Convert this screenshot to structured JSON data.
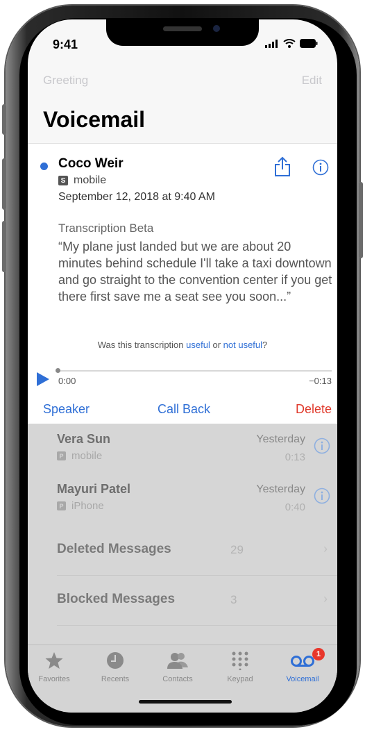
{
  "status": {
    "time": "9:41"
  },
  "nav": {
    "left": "Greeting",
    "right": "Edit",
    "title": "Voicemail"
  },
  "voicemail": {
    "caller": "Coco Weir",
    "label_badge": "S",
    "label": "mobile",
    "date": "September 12, 2018 at 9:40 AM",
    "transcription_title": "Transcription Beta",
    "transcription": "“My plane just landed but we are about 20 minutes behind schedule I'll take a taxi downtown and go straight to the convention center if you get there first save me a seat see you soon...”",
    "feedback_prefix": "Was this transcription",
    "feedback_useful": "useful",
    "feedback_or": "or",
    "feedback_not_useful": "not useful",
    "feedback_suffix": "?",
    "time_start": "0:00",
    "time_end": "−0:13",
    "progress": 0,
    "speaker": "Speaker",
    "call_back": "Call Back",
    "delete": "Delete"
  },
  "messages": [
    {
      "name": "Vera Sun",
      "badge": "P",
      "label": "mobile",
      "date": "Yesterday",
      "duration": "0:13"
    },
    {
      "name": "Mayuri Patel",
      "badge": "P",
      "label": "iPhone",
      "date": "Yesterday",
      "duration": "0:40"
    }
  ],
  "folders": [
    {
      "name": "Deleted Messages",
      "count": "29"
    },
    {
      "name": "Blocked Messages",
      "count": "3"
    }
  ],
  "tabs": [
    {
      "label": "Favorites",
      "icon": "star-icon"
    },
    {
      "label": "Recents",
      "icon": "clock-icon"
    },
    {
      "label": "Contacts",
      "icon": "contacts-icon"
    },
    {
      "label": "Keypad",
      "icon": "keypad-icon"
    },
    {
      "label": "Voicemail",
      "icon": "voicemail-icon",
      "badge": "1",
      "active": true
    }
  ],
  "colors": {
    "accent": "#2f6fd6",
    "destructive": "#e03a2c",
    "badge": "#e8362b"
  }
}
